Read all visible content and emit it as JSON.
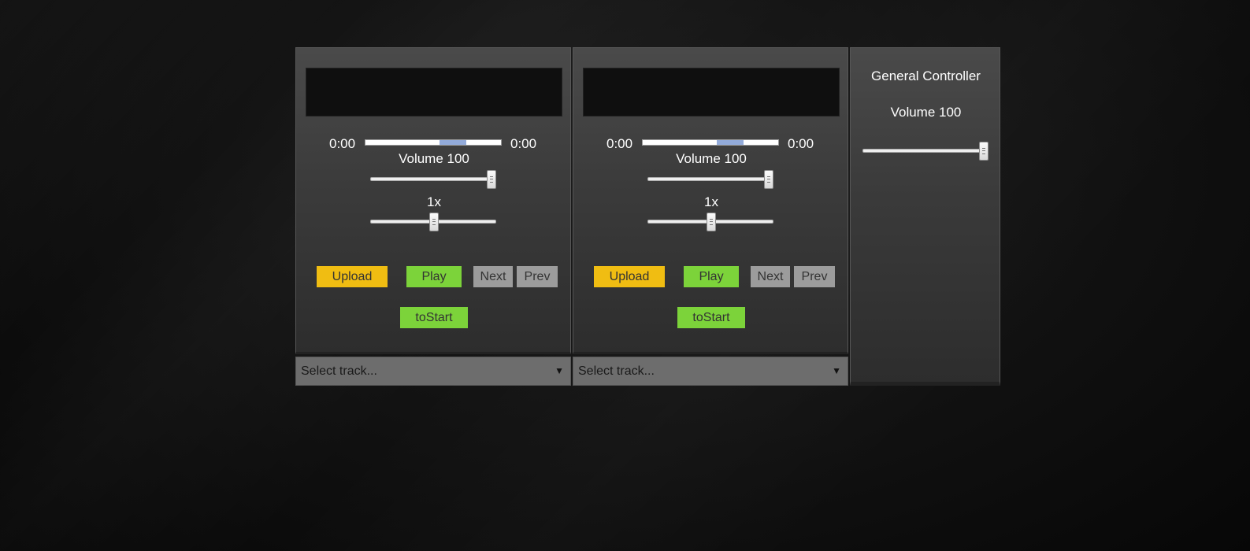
{
  "decks": [
    {
      "current_time": "0:00",
      "duration": "0:00",
      "volume_label": "Volume 100",
      "volume": 100,
      "speed_label": "1x",
      "speed": 1,
      "buttons": {
        "upload": "Upload",
        "play": "Play",
        "next": "Next",
        "prev": "Prev",
        "to_start": "toStart"
      },
      "select": {
        "label": "Select track...",
        "arrow": "▼"
      }
    },
    {
      "current_time": "0:00",
      "duration": "0:00",
      "volume_label": "Volume 100",
      "volume": 100,
      "speed_label": "1x",
      "speed": 1,
      "buttons": {
        "upload": "Upload",
        "play": "Play",
        "next": "Next",
        "prev": "Prev",
        "to_start": "toStart"
      },
      "select": {
        "label": "Select track...",
        "arrow": "▼"
      }
    }
  ],
  "general": {
    "title": "General Controller",
    "volume_label": "Volume 100",
    "volume": 100
  },
  "colors": {
    "upload": "#f0bd12",
    "play": "#7cd33a",
    "nav": "#9c9c9c",
    "seek_buffer": "#93abda"
  }
}
